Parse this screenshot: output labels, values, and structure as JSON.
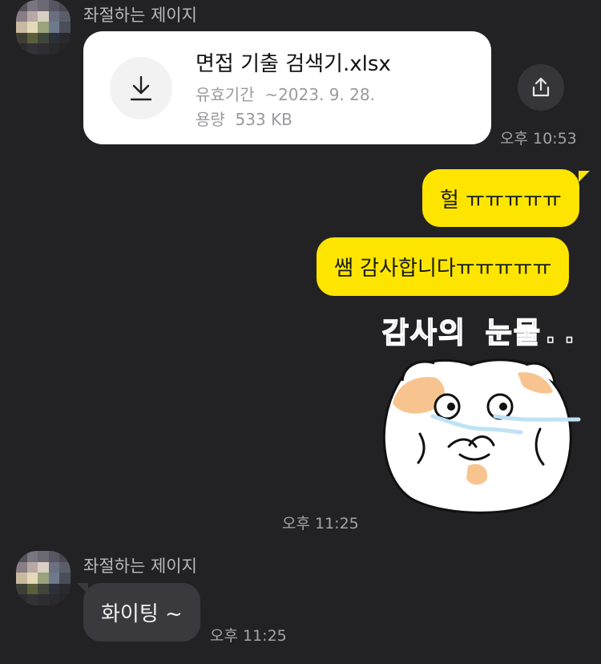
{
  "chat": {
    "sender_name": "좌절하는 제이지",
    "file_message": {
      "file_name": "면접 기출 검색기.xlsx",
      "expiry_label": "유효기간",
      "expiry_value": "~2023. 9. 28.",
      "size_label": "용량",
      "size_value": "533 KB",
      "time": "오후 10:53",
      "download_icon": "download-icon",
      "share_icon": "share-icon"
    },
    "my_messages": [
      {
        "text": "헐 ㅠㅠㅠㅠㅠ"
      },
      {
        "text": "쌤 감사합니다ㅠㅠㅠㅠㅠ"
      }
    ],
    "sticker": {
      "caption": "감사의 눈물..",
      "time": "오후 11:25"
    },
    "reply": {
      "text": "화이팅 ~",
      "time": "오후 11:25"
    }
  },
  "colors": {
    "background": "#222225",
    "my_bubble": "#fee500",
    "other_bubble": "#3a3a3e",
    "card": "#ffffff"
  }
}
